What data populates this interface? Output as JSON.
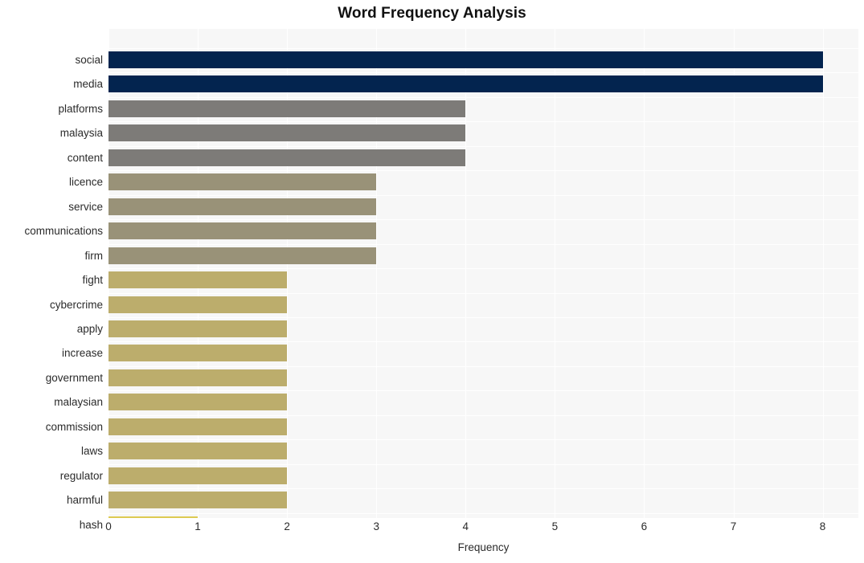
{
  "chart_data": {
    "type": "bar",
    "orientation": "horizontal",
    "title": "Word Frequency Analysis",
    "xlabel": "Frequency",
    "ylabel": "",
    "xlim": [
      0,
      8.4
    ],
    "xticks": [
      0,
      1,
      2,
      3,
      4,
      5,
      6,
      7,
      8
    ],
    "xtick_labels": [
      "0",
      "1",
      "2",
      "3",
      "4",
      "5",
      "6",
      "7",
      "8"
    ],
    "grid": true,
    "legend": "none",
    "categories": [
      "social",
      "media",
      "platforms",
      "malaysia",
      "content",
      "licence",
      "service",
      "communications",
      "firm",
      "fight",
      "cybercrime",
      "apply",
      "increase",
      "government",
      "malaysian",
      "commission",
      "laws",
      "regulator",
      "harmful",
      "hash"
    ],
    "values": [
      8,
      8,
      4,
      4,
      4,
      3,
      3,
      3,
      3,
      2,
      2,
      2,
      2,
      2,
      2,
      2,
      2,
      2,
      2,
      1
    ],
    "bar_colors": [
      "#03244f",
      "#03244f",
      "#7d7b78",
      "#7d7b78",
      "#7d7b78",
      "#999278",
      "#999278",
      "#999278",
      "#999278",
      "#bcad6c",
      "#bcad6c",
      "#bcad6c",
      "#bcad6c",
      "#bcad6c",
      "#bcad6c",
      "#bcad6c",
      "#bcad6c",
      "#bcad6c",
      "#bcad6c",
      "#ddca52"
    ]
  },
  "style": {
    "plot_background": "#f7f7f7",
    "page_background": "#ffffff",
    "gridline_color": "#ffffff",
    "text_color": "#2b2b2b",
    "title_color": "#111111"
  }
}
